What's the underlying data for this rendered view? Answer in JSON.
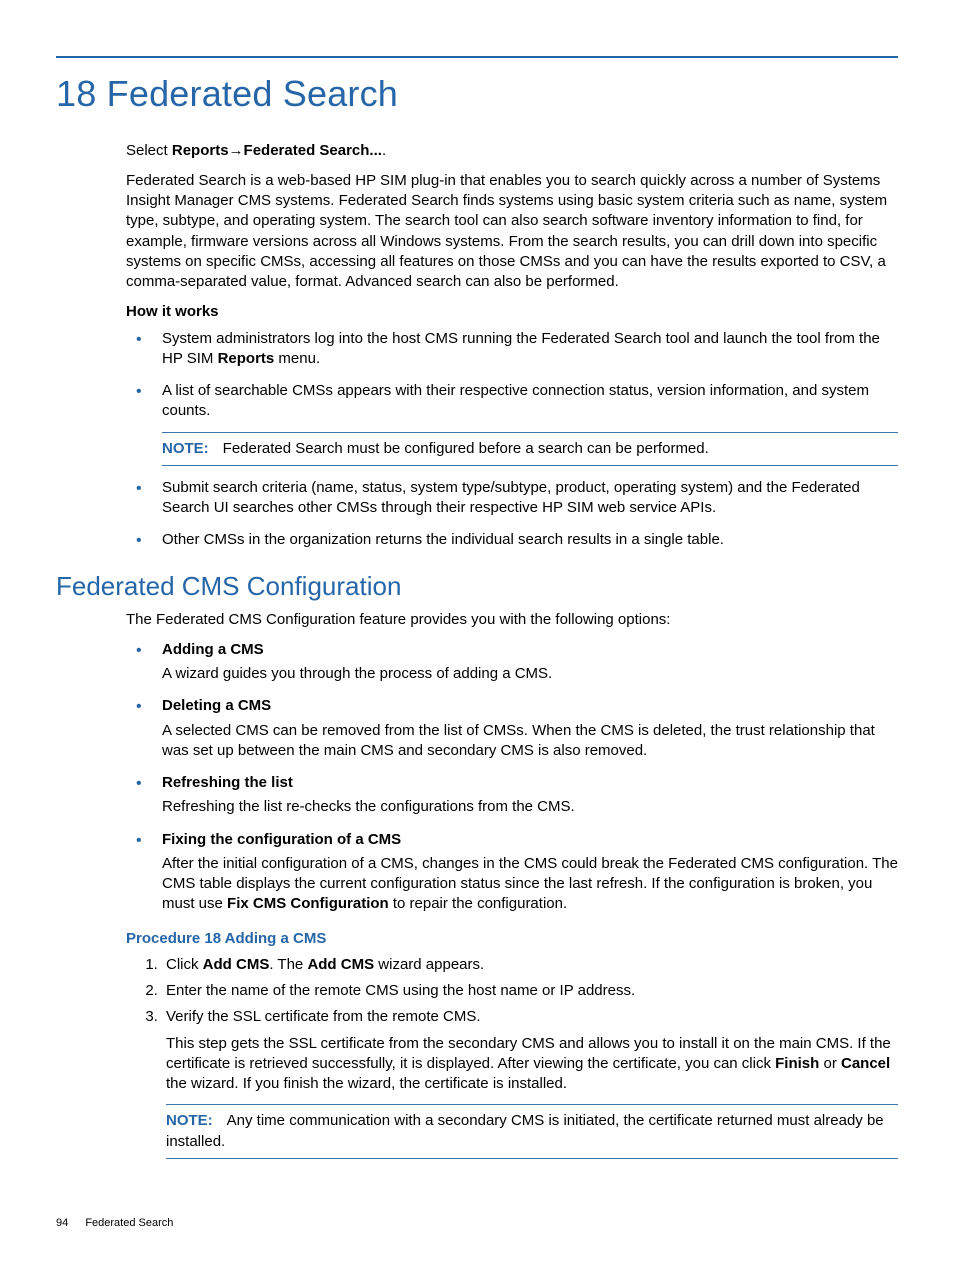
{
  "chapter": {
    "number": "18",
    "title": "Federated Search"
  },
  "intro": {
    "nav_prefix": "Select ",
    "nav_bold1": "Reports",
    "nav_arrow": "→",
    "nav_bold2": "Federated Search...",
    "nav_suffix": ".",
    "body": "Federated Search is a web-based HP SIM plug-in that enables you to search quickly across a number of Systems Insight Manager CMS systems. Federated Search finds systems using basic system criteria such as name, system type, subtype, and operating system. The search tool can also search software inventory information to find, for example, firmware versions across all Windows systems. From the search results, you can drill down into specific systems on specific CMSs, accessing all features on those CMSs and you can have the results exported to CSV, a comma-separated value, format. Advanced search can also be performed."
  },
  "how_it_works": {
    "heading": "How it works",
    "items": {
      "item1_pre": "System administrators log into the host CMS running the Federated Search tool and launch the tool from the HP SIM ",
      "item1_bold": "Reports",
      "item1_post": " menu.",
      "item2": "A list of searchable CMSs appears with their respective connection status, version information, and system counts.",
      "note_label": "NOTE:",
      "note_text": "Federated Search must be configured before a search can be performed.",
      "item3": "Submit search criteria (name, status, system type/subtype, product, operating system) and the Federated Search UI searches other CMSs through their respective HP SIM web service APIs.",
      "item4": "Other CMSs in the organization returns the individual search results in a single table."
    }
  },
  "fed_cms": {
    "heading": "Federated CMS Configuration",
    "intro": "The Federated CMS Configuration feature provides you with the following options:",
    "options": {
      "add_head": "Adding a CMS",
      "add_text": "A wizard guides you through the process of adding a CMS.",
      "del_head": "Deleting a CMS",
      "del_text": "A selected CMS can be removed from the list of CMSs. When the CMS is deleted, the trust relationship that was set up between the main CMS and secondary CMS is also removed.",
      "ref_head": "Refreshing the list",
      "ref_text": "Refreshing the list re-checks the configurations from the CMS.",
      "fix_head": "Fixing the configuration of a CMS",
      "fix_pre": "After the initial configuration of a CMS, changes in the CMS could break the Federated CMS configuration. The CMS table displays the current configuration status since the last refresh. If the configuration is broken, you must use ",
      "fix_bold": "Fix CMS Configuration",
      "fix_post": " to repair the configuration."
    }
  },
  "procedure": {
    "title": "Procedure 18 Adding a CMS",
    "step1_pre": "Click ",
    "step1_b1": "Add CMS",
    "step1_mid": ". The ",
    "step1_b2": "Add CMS",
    "step1_post": " wizard appears.",
    "step2": "Enter the name of the remote CMS using the host name or IP address.",
    "step3": "Verify the SSL certificate from the remote CMS.",
    "step3_extra_pre": "This step gets the SSL certificate from the secondary CMS and allows you to install it on the main CMS. If the certificate is retrieved successfully, it is displayed. After viewing the certificate, you can click ",
    "step3_b1": "Finish",
    "step3_mid": " or ",
    "step3_b2": "Cancel",
    "step3_post": " the wizard. If you finish the wizard, the certificate is installed.",
    "note_label": "NOTE:",
    "note_text": "Any time communication with a secondary CMS is initiated, the certificate returned must already be installed."
  },
  "footer": {
    "page": "94",
    "section": "Federated Search"
  }
}
